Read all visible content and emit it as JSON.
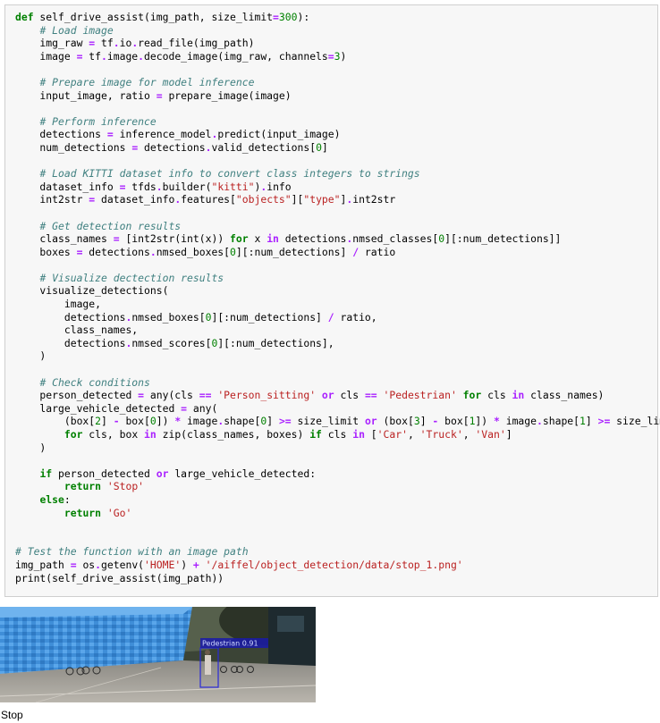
{
  "code_cell": {
    "lines": [
      [
        {
          "t": "def",
          "c": "kw"
        },
        {
          "t": " self_drive_assist(img_path, size_limit"
        },
        {
          "t": "=",
          "c": "op"
        },
        {
          "t": "300",
          "c": "num"
        },
        {
          "t": "):"
        }
      ],
      [
        {
          "t": "    "
        },
        {
          "t": "# Load image",
          "c": "cm"
        }
      ],
      [
        {
          "t": "    img_raw "
        },
        {
          "t": "=",
          "c": "op"
        },
        {
          "t": " tf"
        },
        {
          "t": ".",
          "c": "op"
        },
        {
          "t": "io"
        },
        {
          "t": ".",
          "c": "op"
        },
        {
          "t": "read_file(img_path)"
        }
      ],
      [
        {
          "t": "    image "
        },
        {
          "t": "=",
          "c": "op"
        },
        {
          "t": " tf"
        },
        {
          "t": ".",
          "c": "op"
        },
        {
          "t": "image"
        },
        {
          "t": ".",
          "c": "op"
        },
        {
          "t": "decode_image(img_raw, channels"
        },
        {
          "t": "=",
          "c": "op"
        },
        {
          "t": "3",
          "c": "num"
        },
        {
          "t": ")"
        }
      ],
      [
        {
          "t": ""
        }
      ],
      [
        {
          "t": "    "
        },
        {
          "t": "# Prepare image for model inference",
          "c": "cm"
        }
      ],
      [
        {
          "t": "    input_image, ratio "
        },
        {
          "t": "=",
          "c": "op"
        },
        {
          "t": " prepare_image(image)"
        }
      ],
      [
        {
          "t": ""
        }
      ],
      [
        {
          "t": "    "
        },
        {
          "t": "# Perform inference",
          "c": "cm"
        }
      ],
      [
        {
          "t": "    detections "
        },
        {
          "t": "=",
          "c": "op"
        },
        {
          "t": " inference_model"
        },
        {
          "t": ".",
          "c": "op"
        },
        {
          "t": "predict(input_image)"
        }
      ],
      [
        {
          "t": "    num_detections "
        },
        {
          "t": "=",
          "c": "op"
        },
        {
          "t": " detections"
        },
        {
          "t": ".",
          "c": "op"
        },
        {
          "t": "valid_detections["
        },
        {
          "t": "0",
          "c": "num"
        },
        {
          "t": "]"
        }
      ],
      [
        {
          "t": ""
        }
      ],
      [
        {
          "t": "    "
        },
        {
          "t": "# Load KITTI dataset info to convert class integers to strings",
          "c": "cm"
        }
      ],
      [
        {
          "t": "    dataset_info "
        },
        {
          "t": "=",
          "c": "op"
        },
        {
          "t": " tfds"
        },
        {
          "t": ".",
          "c": "op"
        },
        {
          "t": "builder("
        },
        {
          "t": "\"kitti\"",
          "c": "str"
        },
        {
          "t": ")"
        },
        {
          "t": ".",
          "c": "op"
        },
        {
          "t": "info"
        }
      ],
      [
        {
          "t": "    int2str "
        },
        {
          "t": "=",
          "c": "op"
        },
        {
          "t": " dataset_info"
        },
        {
          "t": ".",
          "c": "op"
        },
        {
          "t": "features["
        },
        {
          "t": "\"objects\"",
          "c": "str"
        },
        {
          "t": "]["
        },
        {
          "t": "\"type\"",
          "c": "str"
        },
        {
          "t": "]"
        },
        {
          "t": ".",
          "c": "op"
        },
        {
          "t": "int2str"
        }
      ],
      [
        {
          "t": ""
        }
      ],
      [
        {
          "t": "    "
        },
        {
          "t": "# Get detection results",
          "c": "cm"
        }
      ],
      [
        {
          "t": "    class_names "
        },
        {
          "t": "=",
          "c": "op"
        },
        {
          "t": " [int2str(int(x)) "
        },
        {
          "t": "for",
          "c": "kw"
        },
        {
          "t": " x "
        },
        {
          "t": "in",
          "c": "op"
        },
        {
          "t": " detections"
        },
        {
          "t": ".",
          "c": "op"
        },
        {
          "t": "nmsed_classes["
        },
        {
          "t": "0",
          "c": "num"
        },
        {
          "t": "][:num_detections]]"
        }
      ],
      [
        {
          "t": "    boxes "
        },
        {
          "t": "=",
          "c": "op"
        },
        {
          "t": " detections"
        },
        {
          "t": ".",
          "c": "op"
        },
        {
          "t": "nmsed_boxes["
        },
        {
          "t": "0",
          "c": "num"
        },
        {
          "t": "][:num_detections] "
        },
        {
          "t": "/",
          "c": "op"
        },
        {
          "t": " ratio"
        }
      ],
      [
        {
          "t": ""
        }
      ],
      [
        {
          "t": "    "
        },
        {
          "t": "# Visualize dectection results",
          "c": "cm"
        }
      ],
      [
        {
          "t": "    visualize_detections("
        }
      ],
      [
        {
          "t": "        image,"
        }
      ],
      [
        {
          "t": "        detections"
        },
        {
          "t": ".",
          "c": "op"
        },
        {
          "t": "nmsed_boxes["
        },
        {
          "t": "0",
          "c": "num"
        },
        {
          "t": "][:num_detections] "
        },
        {
          "t": "/",
          "c": "op"
        },
        {
          "t": " ratio,"
        }
      ],
      [
        {
          "t": "        class_names,"
        }
      ],
      [
        {
          "t": "        detections"
        },
        {
          "t": ".",
          "c": "op"
        },
        {
          "t": "nmsed_scores["
        },
        {
          "t": "0",
          "c": "num"
        },
        {
          "t": "][:num_detections],"
        }
      ],
      [
        {
          "t": "    )"
        }
      ],
      [
        {
          "t": ""
        }
      ],
      [
        {
          "t": "    "
        },
        {
          "t": "# Check conditions",
          "c": "cm"
        }
      ],
      [
        {
          "t": "    person_detected "
        },
        {
          "t": "=",
          "c": "op"
        },
        {
          "t": " any(cls "
        },
        {
          "t": "==",
          "c": "op"
        },
        {
          "t": " "
        },
        {
          "t": "'Person_sitting'",
          "c": "str"
        },
        {
          "t": " "
        },
        {
          "t": "or",
          "c": "op"
        },
        {
          "t": " cls "
        },
        {
          "t": "==",
          "c": "op"
        },
        {
          "t": " "
        },
        {
          "t": "'Pedestrian'",
          "c": "str"
        },
        {
          "t": " "
        },
        {
          "t": "for",
          "c": "kw"
        },
        {
          "t": " cls "
        },
        {
          "t": "in",
          "c": "op"
        },
        {
          "t": " class_names)"
        }
      ],
      [
        {
          "t": "    large_vehicle_detected "
        },
        {
          "t": "=",
          "c": "op"
        },
        {
          "t": " any("
        }
      ],
      [
        {
          "t": "        (box["
        },
        {
          "t": "2",
          "c": "num"
        },
        {
          "t": "] "
        },
        {
          "t": "-",
          "c": "op"
        },
        {
          "t": " box["
        },
        {
          "t": "0",
          "c": "num"
        },
        {
          "t": "]) "
        },
        {
          "t": "*",
          "c": "op"
        },
        {
          "t": " image"
        },
        {
          "t": ".",
          "c": "op"
        },
        {
          "t": "shape["
        },
        {
          "t": "0",
          "c": "num"
        },
        {
          "t": "] "
        },
        {
          "t": ">=",
          "c": "op"
        },
        {
          "t": " size_limit "
        },
        {
          "t": "or",
          "c": "op"
        },
        {
          "t": " (box["
        },
        {
          "t": "3",
          "c": "num"
        },
        {
          "t": "] "
        },
        {
          "t": "-",
          "c": "op"
        },
        {
          "t": " box["
        },
        {
          "t": "1",
          "c": "num"
        },
        {
          "t": "]) "
        },
        {
          "t": "*",
          "c": "op"
        },
        {
          "t": " image"
        },
        {
          "t": ".",
          "c": "op"
        },
        {
          "t": "shape["
        },
        {
          "t": "1",
          "c": "num"
        },
        {
          "t": "] "
        },
        {
          "t": ">=",
          "c": "op"
        },
        {
          "t": " size_limit"
        }
      ],
      [
        {
          "t": "        "
        },
        {
          "t": "for",
          "c": "kw"
        },
        {
          "t": " cls, box "
        },
        {
          "t": "in",
          "c": "op"
        },
        {
          "t": " zip(class_names, boxes) "
        },
        {
          "t": "if",
          "c": "kw"
        },
        {
          "t": " cls "
        },
        {
          "t": "in",
          "c": "op"
        },
        {
          "t": " ["
        },
        {
          "t": "'Car'",
          "c": "str"
        },
        {
          "t": ", "
        },
        {
          "t": "'Truck'",
          "c": "str"
        },
        {
          "t": ", "
        },
        {
          "t": "'Van'",
          "c": "str"
        },
        {
          "t": "]"
        }
      ],
      [
        {
          "t": "    )"
        }
      ],
      [
        {
          "t": ""
        }
      ],
      [
        {
          "t": "    "
        },
        {
          "t": "if",
          "c": "kw"
        },
        {
          "t": " person_detected "
        },
        {
          "t": "or",
          "c": "op"
        },
        {
          "t": " large_vehicle_detected:"
        }
      ],
      [
        {
          "t": "        "
        },
        {
          "t": "return",
          "c": "kw"
        },
        {
          "t": " "
        },
        {
          "t": "'Stop'",
          "c": "str"
        }
      ],
      [
        {
          "t": "    "
        },
        {
          "t": "else",
          "c": "kw"
        },
        {
          "t": ":"
        }
      ],
      [
        {
          "t": "        "
        },
        {
          "t": "return",
          "c": "kw"
        },
        {
          "t": " "
        },
        {
          "t": "'Go'",
          "c": "str"
        }
      ],
      [
        {
          "t": ""
        }
      ],
      [
        {
          "t": ""
        }
      ],
      [
        {
          "t": "# Test the function with an image path",
          "c": "cm"
        }
      ],
      [
        {
          "t": "img_path "
        },
        {
          "t": "=",
          "c": "op"
        },
        {
          "t": " os"
        },
        {
          "t": ".",
          "c": "op"
        },
        {
          "t": "getenv("
        },
        {
          "t": "'HOME'",
          "c": "str"
        },
        {
          "t": ") "
        },
        {
          "t": "+",
          "c": "op"
        },
        {
          "t": " "
        },
        {
          "t": "'/aiffel/object_detection/data/stop_1.png'",
          "c": "str"
        }
      ],
      [
        {
          "t": "print(self_drive_assist(img_path))"
        }
      ]
    ]
  },
  "output": {
    "detection_label": "Pedestrian 0.91",
    "result_text": "Stop"
  },
  "colors": {
    "cell_background": "#f7f7f7",
    "keyword": "#008000",
    "operator": "#aa22ff",
    "string": "#ba2121",
    "comment": "#408080",
    "detection_box": "#2a2ad8"
  }
}
